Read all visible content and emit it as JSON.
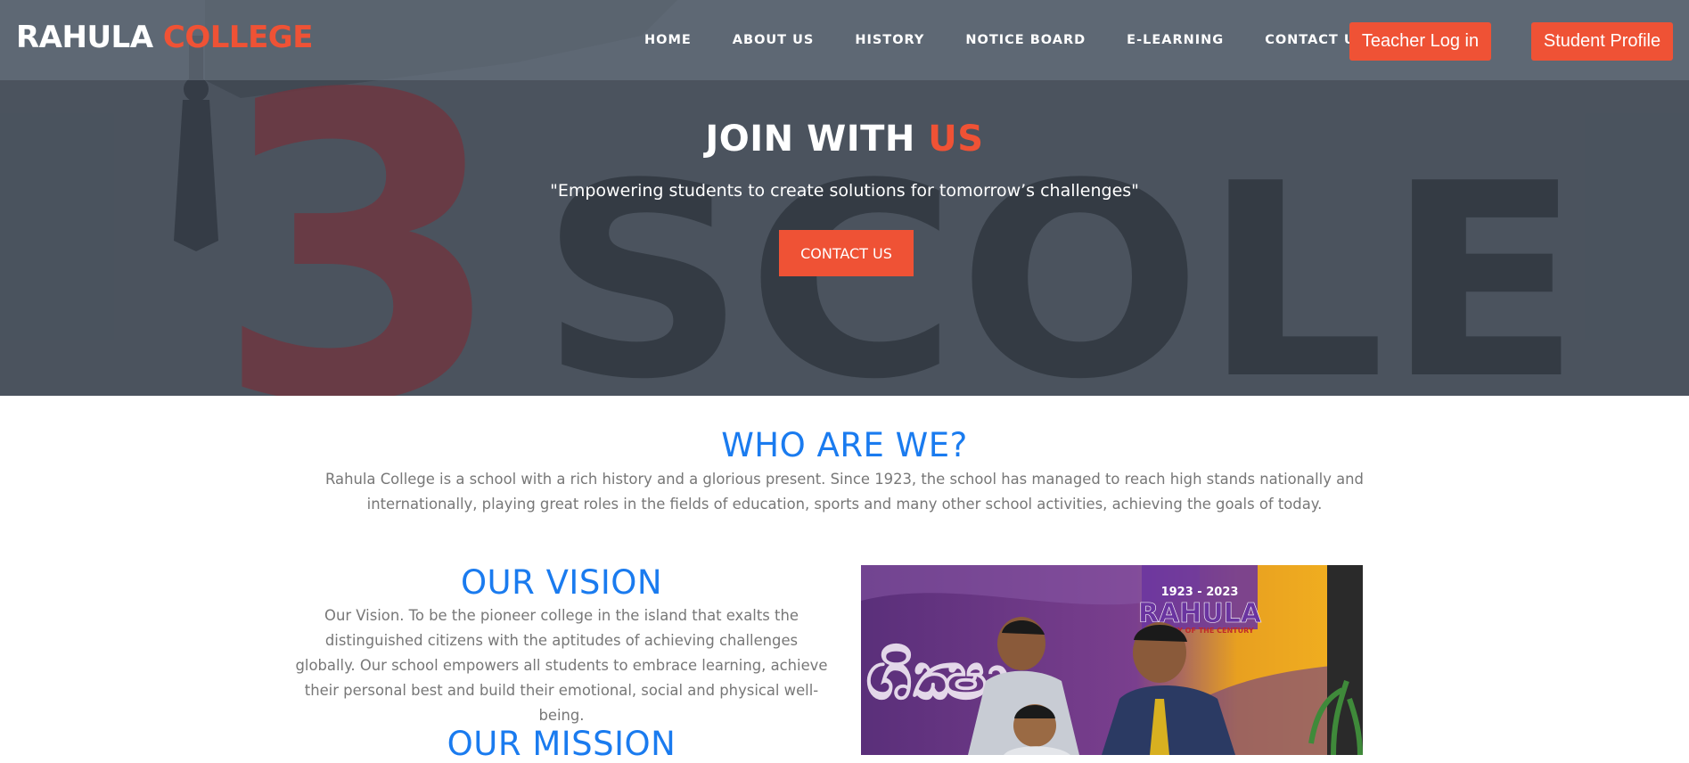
{
  "navbar": {
    "brand_part1": "RAHULA",
    "brand_part2": "COLLEGE",
    "links": [
      "HOME",
      "ABOUT US",
      "HISTORY",
      "NOTICE BOARD",
      "E-LEARNING",
      "CONTACT US"
    ],
    "teacher_login": "Teacher Log in",
    "student_profile": "Student Profile"
  },
  "hero": {
    "title_part1": "JOIN WITH",
    "title_part2": "US",
    "subtitle": "\"Empowering students to create solutions for tomorrow’s challenges\"",
    "button": "CONTACT US",
    "bg_letters": "SCOLE",
    "bg_numeral": "3"
  },
  "who": {
    "title": "WHO ARE WE?",
    "text": "Rahula College is a school with a rich history and a glorious present. Since 1923, the school has managed to reach high stands nationally and internationally, playing great roles in the fields of education, sports and many other school activities, achieving the goals of today."
  },
  "vision": {
    "title": "OUR VISION",
    "text": "Our Vision. To be the pioneer college in the island that exalts the distinguished citizens with the aptitudes of achieving challenges globally. Our school empowers all students to embrace learning, achieve their personal best and build their emotional, social and physical well-being."
  },
  "mission": {
    "title": "OUR MISSION"
  },
  "photo": {
    "banner_years": "1923 - 2023",
    "banner_name": "RAHULA",
    "banner_tagline": "CENTURY OF THE CENTURY"
  },
  "colors": {
    "accent": "#ef5235",
    "heading_blue": "#1a7bef",
    "body_text": "#777777",
    "hero_bg": "#4c5560"
  }
}
